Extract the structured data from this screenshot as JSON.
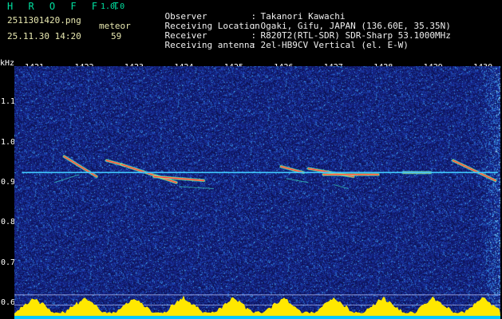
{
  "header": {
    "app_name": "H R O F F T",
    "version": "1.0.0",
    "file_name": "2511301420.png",
    "date_time": "25.11.30 14:20",
    "count_label": "meteor",
    "count_value": "59",
    "info": [
      {
        "key": "Observer",
        "sep": ":",
        "value": "Takanori Kawachi"
      },
      {
        "key": "Receiving Location",
        "sep": ":",
        "value": "Ogaki, Gifu, JAPAN (136.60E, 35.35N)"
      },
      {
        "key": "Receiver",
        "sep": ":",
        "value": "R820T2(RTL-SDR) SDR-Sharp 53.1000MHz"
      },
      {
        "key": "Receiving antenna",
        "sep": ":",
        "value": "2el-HB9CV Vertical (el. E-W)"
      }
    ]
  },
  "axes": {
    "unit": "kHz",
    "time_ticks": [
      "1421",
      "1422",
      "1423",
      "1424",
      "1425",
      "1426",
      "1427",
      "1428",
      "1429",
      "1430"
    ],
    "freq_ticks": [
      "1.1",
      "1.0",
      "0.9",
      "0.8",
      "0.7",
      "0.6"
    ]
  },
  "colors": {
    "background": "#000000",
    "plot_noise_base": "#1a1f6e",
    "carrier_line": "#40c8ff",
    "echo_core": "#ff3050",
    "echo_mid": "#ffe040",
    "echo_edge": "#40ffd0",
    "level_bars": "#ffe800",
    "level_base": "#00c8ff",
    "app_name_color": "#00e0a0",
    "header_text": "#e8e8b0",
    "info_text": "#f0f0f0"
  },
  "chart_data": {
    "type": "heatmap",
    "title": "",
    "xlabel": "",
    "ylabel": "kHz",
    "x_ticks": [
      "1421",
      "1422",
      "1423",
      "1424",
      "1425",
      "1426",
      "1427",
      "1428",
      "1429",
      "1430"
    ],
    "xlim": [
      1420.6,
      1430.35
    ],
    "ylim": [
      0.56,
      1.19
    ],
    "y_ticks": [
      1.1,
      1.0,
      0.9,
      0.8,
      0.7,
      0.6
    ],
    "carrier": {
      "freq": 0.925,
      "x_start": 1420.75,
      "x_end": 1430.3
    },
    "echoes": [
      {
        "x_start": 1421.6,
        "y_start": 0.965,
        "x_end": 1422.25,
        "y_end": 0.915
      },
      {
        "x_start": 1422.45,
        "y_start": 0.955,
        "x_end": 1422.75,
        "y_end": 0.945
      },
      {
        "x_start": 1422.75,
        "y_start": 0.945,
        "x_end": 1423.85,
        "y_end": 0.9
      },
      {
        "x_start": 1423.4,
        "y_start": 0.915,
        "x_end": 1424.4,
        "y_end": 0.905
      },
      {
        "x_start": 1425.95,
        "y_start": 0.94,
        "x_end": 1426.4,
        "y_end": 0.925
      },
      {
        "x_start": 1426.5,
        "y_start": 0.935,
        "x_end": 1427.4,
        "y_end": 0.915
      },
      {
        "x_start": 1426.8,
        "y_start": 0.92,
        "x_end": 1427.9,
        "y_end": 0.92
      },
      {
        "x_start": 1428.4,
        "y_start": 0.925,
        "x_end": 1428.95,
        "y_end": 0.925
      },
      {
        "x_start": 1429.4,
        "y_start": 0.955,
        "x_end": 1430.25,
        "y_end": 0.905
      }
    ],
    "faint_echoes": [
      {
        "x_start": 1421.4,
        "y_start": 0.9,
        "x_end": 1421.9,
        "y_end": 0.92
      },
      {
        "x_start": 1423.9,
        "y_start": 0.89,
        "x_end": 1424.6,
        "y_end": 0.885
      },
      {
        "x_start": 1426.05,
        "y_start": 0.91,
        "x_end": 1426.5,
        "y_end": 0.9
      },
      {
        "x_start": 1427.0,
        "y_start": 0.895,
        "x_end": 1427.3,
        "y_end": 0.885
      }
    ],
    "reference_lines": [
      0.62,
      0.595
    ]
  }
}
